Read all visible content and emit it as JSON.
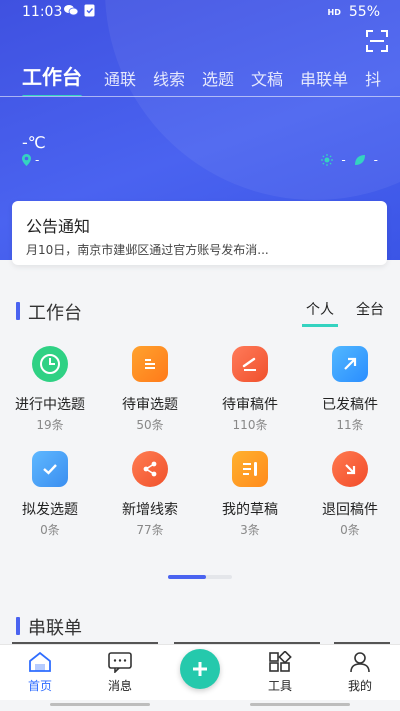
{
  "status": {
    "time": "11:03",
    "hd": "HD",
    "battery": "55%"
  },
  "tabs": [
    "工作台",
    "通联",
    "线索",
    "选题",
    "文稿",
    "串联单",
    "抖"
  ],
  "weather": {
    "temp": "-℃",
    "location": "-",
    "sun": "-",
    "leaf": "-"
  },
  "notice": {
    "title": "公告通知",
    "content": "月10日，南京市建邺区通过官方账号发布消..."
  },
  "workbench": {
    "title": "工作台",
    "scope_personal": "个人",
    "scope_all": "全台",
    "items": [
      {
        "label": "进行中选题",
        "count": "19条"
      },
      {
        "label": "待审选题",
        "count": "50条"
      },
      {
        "label": "待审稿件",
        "count": "110条"
      },
      {
        "label": "已发稿件",
        "count": "11条"
      },
      {
        "label": "拟发选题",
        "count": "0条"
      },
      {
        "label": "新增线索",
        "count": "77条"
      },
      {
        "label": "我的草稿",
        "count": "3条"
      },
      {
        "label": "退回稿件",
        "count": "0条"
      }
    ],
    "page_progress": 0.6
  },
  "rundown": {
    "title": "串联单"
  },
  "bottom_nav": {
    "home": "首页",
    "messages": "消息",
    "tools": "工具",
    "mine": "我的"
  },
  "colors": {
    "primary": "#4a63f0",
    "accent": "#34d3c0",
    "fab": "#25c9ac",
    "active_nav": "#2f6dff"
  }
}
